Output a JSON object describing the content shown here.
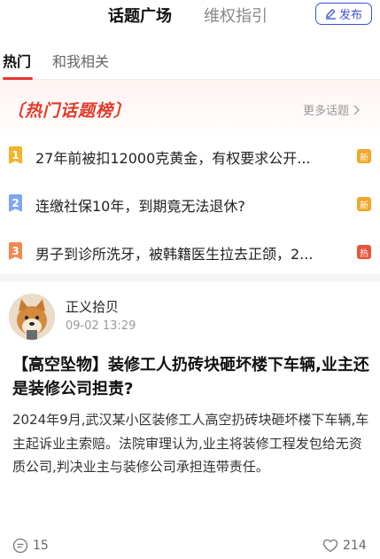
{
  "header": {
    "tabs": [
      {
        "label": "话题广场",
        "active": true
      },
      {
        "label": "维权指引",
        "active": false
      }
    ],
    "publish_label": "发布"
  },
  "subtabs": [
    {
      "label": "热门",
      "active": true
    },
    {
      "label": "和我相关",
      "active": false
    }
  ],
  "hot_topics": {
    "title": "热门话题榜",
    "more_label": "更多话题",
    "items": [
      {
        "rank": "1",
        "text": "27年前被扣12000克黄金，有权要求公开...",
        "badge": "新"
      },
      {
        "rank": "2",
        "text": "连缴社保10年，到期竟无法退休?",
        "badge": "新"
      },
      {
        "rank": "3",
        "text": "男子到诊所洗牙，被韩籍医生拉去正颌，2...",
        "badge": "热"
      }
    ]
  },
  "post": {
    "author": "正义拾贝",
    "time": "09-02 13:29",
    "title": "【高空坠物】装修工人扔砖块砸坏楼下车辆,业主还是装修公司担责?",
    "body": "2024年9月,武汉某小区装修工人高空扔砖块砸坏楼下车辆,车主起诉业主索赔。法院审理认为,业主将装修工程发包给无资质公司,判决业主与装修公司承担连带责任。",
    "comment_count": "15",
    "like_count": "214"
  },
  "colors": {
    "accent_red": "#e23a2b",
    "brand_blue": "#3c52d6"
  }
}
